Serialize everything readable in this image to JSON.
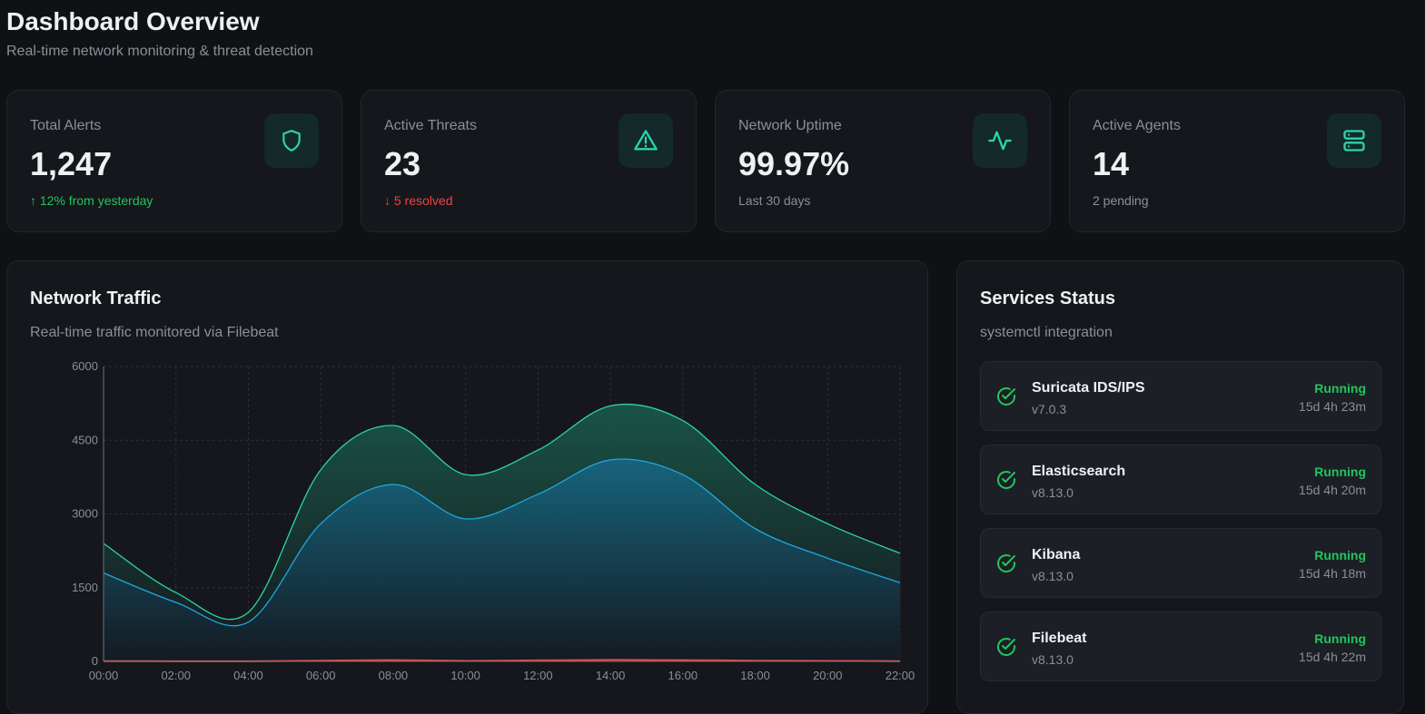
{
  "header": {
    "title": "Dashboard Overview",
    "subtitle": "Real-time network monitoring & threat detection"
  },
  "stats": [
    {
      "label": "Total Alerts",
      "value": "1,247",
      "sub": "↑ 12% from yesterday",
      "sub_color": "#22c55e",
      "icon": "shield-icon"
    },
    {
      "label": "Active Threats",
      "value": "23",
      "sub": "↓ 5 resolved",
      "sub_color": "#ef4444",
      "icon": "alert-triangle-icon"
    },
    {
      "label": "Network Uptime",
      "value": "99.97%",
      "sub": "Last 30 days",
      "sub_color": "#8a8f98",
      "icon": "activity-icon"
    },
    {
      "label": "Active Agents",
      "value": "14",
      "sub": "2 pending",
      "sub_color": "#8a8f98",
      "icon": "server-icon"
    }
  ],
  "traffic": {
    "title": "Network Traffic",
    "subtitle": "Real-time traffic monitored via Filebeat"
  },
  "chart_data": {
    "type": "area",
    "categories": [
      "00:00",
      "02:00",
      "04:00",
      "06:00",
      "08:00",
      "10:00",
      "12:00",
      "14:00",
      "16:00",
      "18:00",
      "20:00",
      "22:00"
    ],
    "series": [
      {
        "values": [
          2400,
          1400,
          1000,
          3900,
          4800,
          3800,
          4300,
          5200,
          4900,
          3600,
          2800,
          2200
        ],
        "color": "#2dd4a8"
      },
      {
        "values": [
          1800,
          1200,
          800,
          2800,
          3600,
          2900,
          3400,
          4100,
          3800,
          2700,
          2100,
          1600
        ],
        "color": "#1ea7e0"
      },
      {
        "values": [
          5,
          3,
          2,
          15,
          25,
          10,
          20,
          30,
          25,
          15,
          10,
          5
        ],
        "color": "#ef4444"
      }
    ],
    "yticks": [
      "0",
      "1500",
      "3000",
      "4500",
      "6000"
    ],
    "ylim": [
      0,
      6000
    ],
    "grid": true
  },
  "services": {
    "title": "Services Status",
    "subtitle": "systemctl integration",
    "items": [
      {
        "name": "Suricata IDS/IPS",
        "version": "v7.0.3",
        "status": "Running",
        "uptime": "15d 4h 23m"
      },
      {
        "name": "Elasticsearch",
        "version": "v8.13.0",
        "status": "Running",
        "uptime": "15d 4h 20m"
      },
      {
        "name": "Kibana",
        "version": "v8.13.0",
        "status": "Running",
        "uptime": "15d 4h 18m"
      },
      {
        "name": "Filebeat",
        "version": "v8.13.0",
        "status": "Running",
        "uptime": "15d 4h 22m"
      }
    ]
  }
}
